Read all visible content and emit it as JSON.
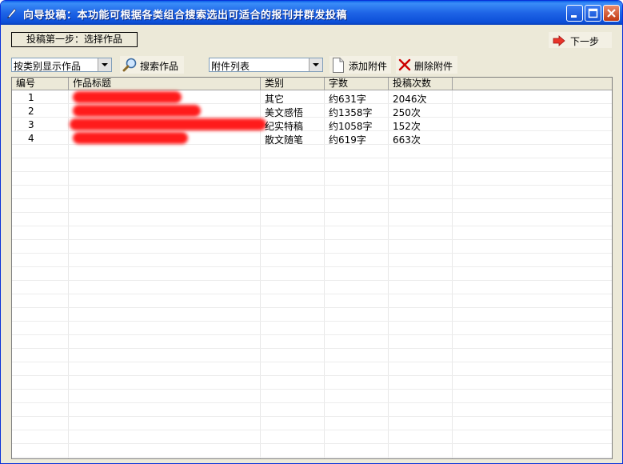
{
  "window": {
    "title": "向导投稿：本功能可根据各类组合搜索选出可适合的报刊并群发投稿",
    "controls": {
      "minimize": "minimize-icon",
      "maximize": "maximize-icon",
      "close": "close-icon"
    }
  },
  "step": {
    "label": "投稿第一步：选择作品"
  },
  "next_button": {
    "label": "下一步",
    "icon": "next-arrow-icon"
  },
  "toolbar": {
    "category_select": {
      "value": "按类别显示作品"
    },
    "search_button": {
      "label": "搜索作品",
      "icon": "magnifier-icon"
    },
    "attachment_select": {
      "value": "附件列表"
    },
    "add_attachment_button": {
      "label": "添加附件",
      "icon": "document-icon"
    },
    "delete_attachment_button": {
      "label": "删除附件",
      "icon": "delete-x-icon",
      "icon_color": "#cc0000"
    }
  },
  "table": {
    "columns": [
      "编号",
      "作品标题",
      "类别",
      "字数",
      "投稿次数"
    ],
    "rows": [
      {
        "id": "1",
        "title": "",
        "category": "其它",
        "words": "约631字",
        "submissions": "2046次"
      },
      {
        "id": "2",
        "title": "",
        "category": "美文感悟",
        "words": "约1358字",
        "submissions": "250次"
      },
      {
        "id": "3",
        "title": "",
        "category": "纪实特稿",
        "words": "约1058字",
        "submissions": "152次"
      },
      {
        "id": "4",
        "title": "",
        "category": "散文随笔",
        "words": "约619字",
        "submissions": "663次"
      }
    ],
    "redaction_color": "#ff1b1b"
  }
}
